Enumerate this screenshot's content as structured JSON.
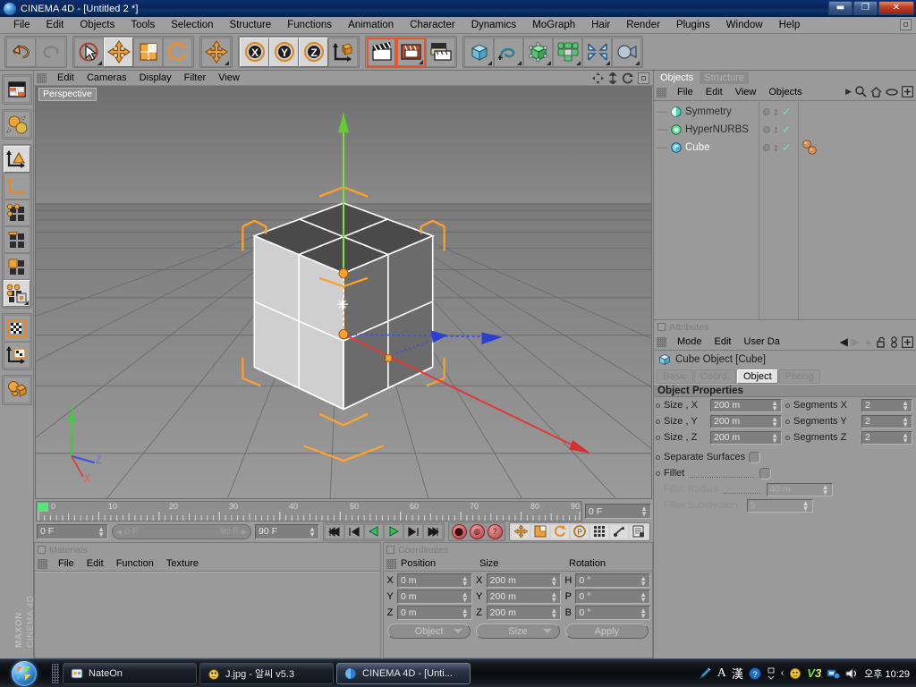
{
  "window": {
    "title": "CINEMA 4D - [Untitled 2 *]",
    "minimize": "—",
    "maximize": "❐",
    "close": "✕"
  },
  "menubar": {
    "items": [
      "File",
      "Edit",
      "Objects",
      "Tools",
      "Selection",
      "Structure",
      "Functions",
      "Animation",
      "Character",
      "Dynamics",
      "MoGraph",
      "Hair",
      "Render",
      "Plugins",
      "Window",
      "Help"
    ]
  },
  "toolbar": {
    "groups": [
      {
        "name": "history",
        "buttons": [
          {
            "icon": "undo-icon",
            "label": "Undo",
            "state": "normal"
          },
          {
            "icon": "redo-icon",
            "label": "Redo",
            "state": "disabled"
          }
        ]
      },
      {
        "name": "tools",
        "buttons": [
          {
            "icon": "select-cursor-icon",
            "label": "Live Selection",
            "state": "normal",
            "arrow": true
          },
          {
            "icon": "move-icon",
            "label": "Move",
            "state": "selected"
          },
          {
            "icon": "scale-icon",
            "label": "Scale",
            "state": "normal"
          },
          {
            "icon": "rotate-icon",
            "label": "Rotate",
            "state": "normal"
          }
        ]
      },
      {
        "name": "axis",
        "buttons": [
          {
            "icon": "move-icon",
            "label": "Move Axis",
            "state": "normal",
            "arrow": true
          }
        ]
      },
      {
        "name": "lock-axis",
        "buttons": [
          {
            "icon": "x-axis-icon",
            "label": "X",
            "state": "selected"
          },
          {
            "icon": "y-axis-icon",
            "label": "Y",
            "state": "selected"
          },
          {
            "icon": "z-axis-icon",
            "label": "Z",
            "state": "selected"
          },
          {
            "icon": "world-coordinates-icon",
            "label": "World/Object Coordinate System",
            "state": "normal"
          }
        ]
      },
      {
        "name": "render",
        "buttons": [
          {
            "icon": "render-view-icon",
            "label": "Render View",
            "state": "highlighted"
          },
          {
            "icon": "render-region-icon",
            "label": "Render Region",
            "state": "highlighted"
          },
          {
            "icon": "render-settings-icon",
            "label": "Render Settings",
            "state": "normal",
            "arrow": true
          }
        ]
      },
      {
        "name": "create",
        "buttons": [
          {
            "icon": "cube-primitive-icon",
            "label": "Add Cube Object",
            "state": "normal",
            "arrow": true
          },
          {
            "icon": "spline-icon",
            "label": "Add Spline",
            "state": "normal",
            "arrow": true
          },
          {
            "icon": "nurbs-icon",
            "label": "Add HyperNURBS",
            "state": "normal",
            "arrow": true
          },
          {
            "icon": "array-icon",
            "label": "Add Array Object",
            "state": "normal",
            "arrow": true
          },
          {
            "icon": "deformer-icon",
            "label": "Add Bend Object",
            "state": "normal",
            "arrow": true
          },
          {
            "icon": "camera-icon",
            "label": "Add Camera",
            "state": "normal",
            "arrow": true
          }
        ]
      }
    ]
  },
  "leftbar": {
    "groups": [
      {
        "items": [
          {
            "icon": "model-mode-icon",
            "label": "Make Editable",
            "state": "normal"
          }
        ]
      },
      {
        "items": [
          {
            "icon": "object-axis-icon",
            "label": "Model / Object Mode",
            "state": "normal"
          }
        ]
      },
      {
        "items": [
          {
            "icon": "model-tool-icon",
            "label": "Model Mode",
            "state": "selected"
          },
          {
            "icon": "object-tool-icon",
            "label": "Object Mode",
            "state": "normal"
          },
          {
            "icon": "point-mode-icon",
            "label": "Points",
            "state": "normal"
          },
          {
            "icon": "edge-mode-icon",
            "label": "Edges",
            "state": "normal"
          },
          {
            "icon": "polygon-mode-icon",
            "label": "Polygons",
            "state": "normal"
          },
          {
            "icon": "animation-mode-icon",
            "label": "Animation Mode",
            "state": "selected",
            "arrow": true
          }
        ]
      },
      {
        "items": [
          {
            "icon": "texture-mode-icon",
            "label": "Texture Mode",
            "state": "normal"
          },
          {
            "icon": "texture-axis-icon",
            "label": "Texture Axis Mode",
            "state": "normal"
          }
        ]
      },
      {
        "items": [
          {
            "icon": "deformer-point-icon",
            "label": "Enable Deformer",
            "state": "normal"
          }
        ]
      }
    ],
    "brand_line1": "MAXON",
    "brand_line2": "CINEMA 4D"
  },
  "viewport": {
    "menu": [
      "Edit",
      "Cameras",
      "Display",
      "Filter",
      "View"
    ],
    "label": "Perspective",
    "right_icons": [
      "pan-icon",
      "dolly-icon",
      "rotate-view-icon",
      "maximize-view-icon"
    ],
    "axis_gizmo": {
      "x": "X",
      "y": "Y",
      "z": "Z"
    }
  },
  "timeline": {
    "ticks": [
      "0",
      "10",
      "20",
      "30",
      "40",
      "50",
      "60",
      "70",
      "80",
      "90"
    ],
    "current_frame": "0 F",
    "range_start": "0 F",
    "range_start_slider": "0 F",
    "range_end_slider": "90 F",
    "range_end": "90 F",
    "transport": [
      {
        "icon": "go-to-start-icon",
        "label": "Go to Start"
      },
      {
        "icon": "step-back-icon",
        "label": "Go to Previous Frame"
      },
      {
        "icon": "play-reverse-icon",
        "label": "Play Reverse"
      },
      {
        "icon": "play-icon",
        "label": "Play Forward"
      },
      {
        "icon": "step-forward-icon",
        "label": "Go to Next Frame"
      },
      {
        "icon": "go-to-end-icon",
        "label": "Go to End"
      }
    ],
    "record_buttons": [
      {
        "icon": "record-active-icon",
        "label": "Record Active Objects"
      },
      {
        "icon": "autokey-icon",
        "label": "Autokeying"
      },
      {
        "icon": "keyframe-selection-icon",
        "label": "Keyframe Selection"
      }
    ],
    "key_toggles": [
      {
        "icon": "position-key-icon",
        "label": "Position",
        "state": "on"
      },
      {
        "icon": "scale-key-icon",
        "label": "Scale",
        "state": "on"
      },
      {
        "icon": "rotation-key-icon",
        "label": "Rotation",
        "state": "on"
      },
      {
        "icon": "pla-key-icon",
        "label": "PLA",
        "state": "on"
      },
      {
        "icon": "param-key-icon",
        "label": "Parameter",
        "state": "on"
      },
      {
        "icon": "point-level-icon",
        "label": "Point Level Animation",
        "state": "on"
      },
      {
        "icon": "autokey-doc-icon",
        "label": "Auto Keyframing",
        "state": "on"
      }
    ]
  },
  "materials": {
    "title": "Materials",
    "menu": [
      "File",
      "Edit",
      "Function",
      "Texture"
    ]
  },
  "coordinates": {
    "title": "Coordinates",
    "headers": [
      "Position",
      "Size",
      "Rotation"
    ],
    "rows": [
      {
        "pos_axis": "X",
        "pos": "0 m",
        "size_axis": "X",
        "size": "200 m",
        "rot_axis": "H",
        "rot": "0 °"
      },
      {
        "pos_axis": "Y",
        "pos": "0 m",
        "size_axis": "Y",
        "size": "200 m",
        "rot_axis": "P",
        "rot": "0 °"
      },
      {
        "pos_axis": "Z",
        "pos": "0 m",
        "size_axis": "Z",
        "size": "200 m",
        "rot_axis": "B",
        "rot": "0 °"
      }
    ],
    "mode_dropdown": "Object",
    "size_dropdown": "Size",
    "apply_button": "Apply"
  },
  "objects_panel": {
    "tabs": [
      {
        "label": "Objects",
        "active": true
      },
      {
        "label": "Structure",
        "active": false
      }
    ],
    "menu": [
      "File",
      "Edit",
      "View",
      "Objects"
    ],
    "right_icons": [
      "chevron-right-icon",
      "search-icon",
      "home-icon",
      "ellipse-icon",
      "plus-box-icon"
    ],
    "tree": [
      {
        "name": "Symmetry",
        "icon": "symmetry-object-icon",
        "selected": false,
        "tags": 0
      },
      {
        "name": "HyperNURBS",
        "icon": "hypernurbs-object-icon",
        "selected": false,
        "tags": 0
      },
      {
        "name": "Cube",
        "icon": "cube-object-icon",
        "selected": true,
        "tags": 2
      }
    ]
  },
  "attributes": {
    "title": "Attributes",
    "menu": [
      "Mode",
      "Edit",
      "User Da"
    ],
    "nav_icons": [
      "back-arrow-icon",
      "forward-arrow-icon",
      "up-arrow-icon",
      "lock-icon",
      "link-icon",
      "plus-box-icon"
    ],
    "object_title": "Cube Object [Cube]",
    "object_icon": "cube-object-icon",
    "tabs": [
      {
        "label": "Basic",
        "active": false
      },
      {
        "label": "Coord,",
        "active": false
      },
      {
        "label": "Object",
        "active": true
      },
      {
        "label": "Phong",
        "active": false
      }
    ],
    "section_title": "Object Properties",
    "properties": [
      {
        "label": "Size , X",
        "value": "200 m",
        "label2": "Segments X",
        "value2": "2",
        "disabled": false
      },
      {
        "label": "Size , Y",
        "value": "200 m",
        "label2": "Segments Y",
        "value2": "2",
        "disabled": false
      },
      {
        "label": "Size , Z",
        "value": "200 m",
        "label2": "Segments Z",
        "value2": "2",
        "disabled": false
      }
    ],
    "checkboxes": [
      {
        "label": "Separate Surfaces",
        "checked": false,
        "leader": false
      },
      {
        "label": "Fillet",
        "checked": false,
        "leader": true
      }
    ],
    "disabled_fields": [
      {
        "label": "Fillet Radius",
        "value": "40 m",
        "leader": true
      },
      {
        "label": "Fillet Subdivision",
        "value": "5",
        "leader": false
      }
    ]
  },
  "taskbar": {
    "start_label": "Start",
    "tasks": [
      {
        "label": "NateOn",
        "icon": "nateon-icon",
        "active": false
      },
      {
        "label": "J.jpg - 알씨 v5.3",
        "icon": "alsee-icon",
        "active": false
      },
      {
        "label": "CINEMA 4D - [Unti...",
        "icon": "cinema4d-icon",
        "active": true
      }
    ],
    "tray_icons": [
      "pen-icon",
      "ime-a-icon",
      "ime-han-icon",
      "help-icon",
      "expand-icon",
      "left-chevron-icon",
      "emoticon-icon",
      "v3-icon",
      "network-icon",
      "volume-icon"
    ],
    "clock": "오후 10:29"
  },
  "colors": {
    "accent_orange": "#f08a1e",
    "panel_bg": "#9a9a9a",
    "field_bg": "#7f7f7f",
    "title_blue": "#0a2457",
    "selection_orange": "#ff9b26",
    "check_green": "#76e3b8"
  }
}
